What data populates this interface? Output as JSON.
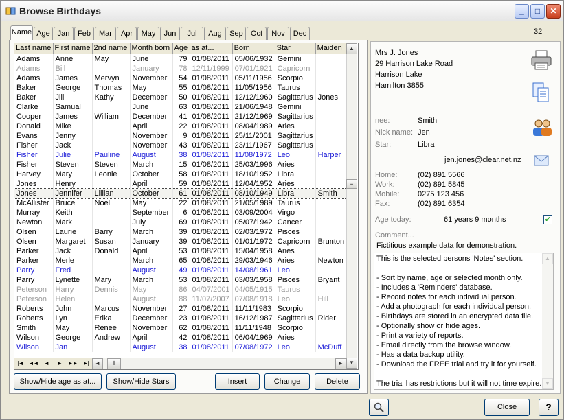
{
  "window": {
    "title": "Browse Birthdays"
  },
  "tabs": [
    "Name",
    "Age",
    "Jan",
    "Feb",
    "Mar",
    "Apr",
    "May",
    "Jun",
    "Jul",
    "Aug",
    "Sep",
    "Oct",
    "Nov",
    "Dec"
  ],
  "active_tab": "Name",
  "record_count": "32",
  "grid": {
    "columns": [
      "Last name",
      "First name",
      "2nd name",
      "Month born",
      "Age",
      "as at...",
      "Born",
      "Star",
      "Maiden"
    ],
    "rows": [
      {
        "c": [
          "Adams",
          "Anne",
          "May",
          "June",
          "79",
          "01/08/2011",
          "05/06/1932",
          "Gemini",
          ""
        ],
        "s": ""
      },
      {
        "c": [
          "Adams",
          "Bill",
          "",
          "January",
          "78",
          "12/11/1999",
          "07/01/1921",
          "Capricorn",
          ""
        ],
        "s": "grey"
      },
      {
        "c": [
          "Adams",
          "James",
          "Mervyn",
          "November",
          "54",
          "01/08/2011",
          "05/11/1956",
          "Scorpio",
          ""
        ],
        "s": ""
      },
      {
        "c": [
          "Baker",
          "George",
          "Thomas",
          "May",
          "55",
          "01/08/2011",
          "11/05/1956",
          "Taurus",
          ""
        ],
        "s": ""
      },
      {
        "c": [
          "Baker",
          "Jill",
          "Kathy",
          "December",
          "50",
          "01/08/2011",
          "12/12/1960",
          "Sagittarius",
          "Jones"
        ],
        "s": ""
      },
      {
        "c": [
          "Clarke",
          "Samual",
          "",
          "June",
          "63",
          "01/08/2011",
          "21/06/1948",
          "Gemini",
          ""
        ],
        "s": ""
      },
      {
        "c": [
          "Cooper",
          "James",
          "William",
          "December",
          "41",
          "01/08/2011",
          "21/12/1969",
          "Sagittarius",
          ""
        ],
        "s": ""
      },
      {
        "c": [
          "Donald",
          "Mike",
          "",
          "April",
          "22",
          "01/08/2011",
          "08/04/1989",
          "Aries",
          ""
        ],
        "s": ""
      },
      {
        "c": [
          "Evans",
          "Jenny",
          "",
          "November",
          "9",
          "01/08/2011",
          "25/11/2001",
          "Sagittarius",
          ""
        ],
        "s": ""
      },
      {
        "c": [
          "Fisher",
          "Jack",
          "",
          "November",
          "43",
          "01/08/2011",
          "23/11/1967",
          "Sagittarius",
          ""
        ],
        "s": ""
      },
      {
        "c": [
          "Fisher",
          "Julie",
          "Pauline",
          "August",
          "38",
          "01/08/2011",
          "11/08/1972",
          "Leo",
          "Harper"
        ],
        "s": "blue"
      },
      {
        "c": [
          "Fisher",
          "Steven",
          "Steven",
          "March",
          "15",
          "01/08/2011",
          "25/03/1996",
          "Aries",
          ""
        ],
        "s": ""
      },
      {
        "c": [
          "Harvey",
          "Mary",
          "Leonie",
          "October",
          "58",
          "01/08/2011",
          "18/10/1952",
          "Libra",
          ""
        ],
        "s": ""
      },
      {
        "c": [
          "Jones",
          "Henry",
          "",
          "April",
          "59",
          "01/08/2011",
          "12/04/1952",
          "Aries",
          ""
        ],
        "s": ""
      },
      {
        "c": [
          "Jones",
          "Jennifer",
          "Lillian",
          "October",
          "61",
          "01/08/2011",
          "08/10/1949",
          "Libra",
          "Smith"
        ],
        "s": "sel"
      },
      {
        "c": [
          "McAllister",
          "Bruce",
          "Noel",
          "May",
          "22",
          "01/08/2011",
          "21/05/1989",
          "Taurus",
          ""
        ],
        "s": ""
      },
      {
        "c": [
          "Murray",
          "Keith",
          "",
          "September",
          "6",
          "01/08/2011",
          "03/09/2004",
          "Virgo",
          ""
        ],
        "s": ""
      },
      {
        "c": [
          "Newton",
          "Mark",
          "",
          "July",
          "69",
          "01/08/2011",
          "05/07/1942",
          "Cancer",
          ""
        ],
        "s": ""
      },
      {
        "c": [
          "Olsen",
          "Laurie",
          "Barry",
          "March",
          "39",
          "01/08/2011",
          "02/03/1972",
          "Pisces",
          ""
        ],
        "s": ""
      },
      {
        "c": [
          "Olsen",
          "Margaret",
          "Susan",
          "January",
          "39",
          "01/08/2011",
          "01/01/1972",
          "Capricorn",
          "Brunton"
        ],
        "s": ""
      },
      {
        "c": [
          "Parker",
          "Jack",
          "Donald",
          "April",
          "53",
          "01/08/2011",
          "15/04/1958",
          "Aries",
          ""
        ],
        "s": ""
      },
      {
        "c": [
          "Parker",
          "Merle",
          "",
          "March",
          "65",
          "01/08/2011",
          "29/03/1946",
          "Aries",
          "Newton"
        ],
        "s": ""
      },
      {
        "c": [
          "Parry",
          "Fred",
          "",
          "August",
          "49",
          "01/08/2011",
          "14/08/1961",
          "Leo",
          ""
        ],
        "s": "blue"
      },
      {
        "c": [
          "Parry",
          "Lynette",
          "Mary",
          "March",
          "53",
          "01/08/2011",
          "03/03/1958",
          "Pisces",
          "Bryant"
        ],
        "s": ""
      },
      {
        "c": [
          "Peterson",
          "Harry",
          "Dennis",
          "May",
          "86",
          "04/07/2001",
          "04/05/1915",
          "Taurus",
          ""
        ],
        "s": "grey"
      },
      {
        "c": [
          "Peterson",
          "Helen",
          "",
          "August",
          "88",
          "11/07/2007",
          "07/08/1918",
          "Leo",
          "Hill"
        ],
        "s": "grey"
      },
      {
        "c": [
          "Roberts",
          "John",
          "Marcus",
          "November",
          "27",
          "01/08/2011",
          "11/11/1983",
          "Scorpio",
          ""
        ],
        "s": ""
      },
      {
        "c": [
          "Roberts",
          "Lyn",
          "Erika",
          "December",
          "23",
          "01/08/2011",
          "16/12/1987",
          "Sagittarius",
          "Rider"
        ],
        "s": ""
      },
      {
        "c": [
          "Smith",
          "May",
          "Renee",
          "November",
          "62",
          "01/08/2011",
          "11/11/1948",
          "Scorpio",
          ""
        ],
        "s": ""
      },
      {
        "c": [
          "Wilson",
          "George",
          "Andrew",
          "April",
          "42",
          "01/08/2011",
          "06/04/1969",
          "Aries",
          ""
        ],
        "s": ""
      },
      {
        "c": [
          "Wilson",
          "Jan",
          "",
          "August",
          "38",
          "01/08/2011",
          "07/08/1972",
          "Leo",
          "McDuff"
        ],
        "s": "blue"
      }
    ]
  },
  "nav_buttons": [
    "|◄",
    "◄◄",
    "◄",
    "►",
    "►►",
    "►|"
  ],
  "buttons": {
    "show_hide_age": "Show/Hide age as at...",
    "show_hide_stars": "Show/Hide Stars",
    "insert": "Insert",
    "change": "Change",
    "delete": "Delete",
    "close": "Close",
    "help": "?"
  },
  "detail": {
    "address": [
      "Mrs J. Jones",
      "29 Harrison Lake Road",
      "Harrison Lake",
      "Hamilton 3855"
    ],
    "nee_label": "nee:",
    "nee": "Smith",
    "nick_label": "Nick name:",
    "nick": "Jen",
    "star_label": "Star:",
    "star": "Libra",
    "email": "jen.jones@clear.net.nz",
    "home_label": "Home:",
    "home": "(02) 891 5566",
    "work_label": "Work:",
    "work": "(02) 891 5845",
    "mobile_label": "Mobile:",
    "mobile": "0275 123 456",
    "fax_label": "Fax:",
    "fax": "(02) 891 6354",
    "age_label": "Age today:",
    "age": "61 years 9 months",
    "comment_label": "Comment...",
    "comment": "Fictitious example data for demonstration.",
    "notes": [
      "This is the selected persons 'Notes' section.",
      "",
      "- Sort by name, age or selected month only.",
      "- Includes a 'Reminders' database.",
      "- Record notes for each individual person.",
      "- Add a photograph for each individual person.",
      "- Birthdays are stored in an encrypted data file.",
      "- Optionally show or hide ages.",
      "- Print a variety of reports.",
      "- Email directly from the browse window.",
      "- Has a data backup utility.",
      "- Download the FREE trial and try it for yourself.",
      "",
      "The trial has restrictions but it will not time expire."
    ]
  },
  "icons": [
    "app-icon",
    "minimize-icon",
    "maximize-icon",
    "close-icon",
    "printer-icon",
    "copy-icon",
    "people-icon",
    "envelope-icon",
    "search-icon",
    "checkbox-checked-icon"
  ]
}
